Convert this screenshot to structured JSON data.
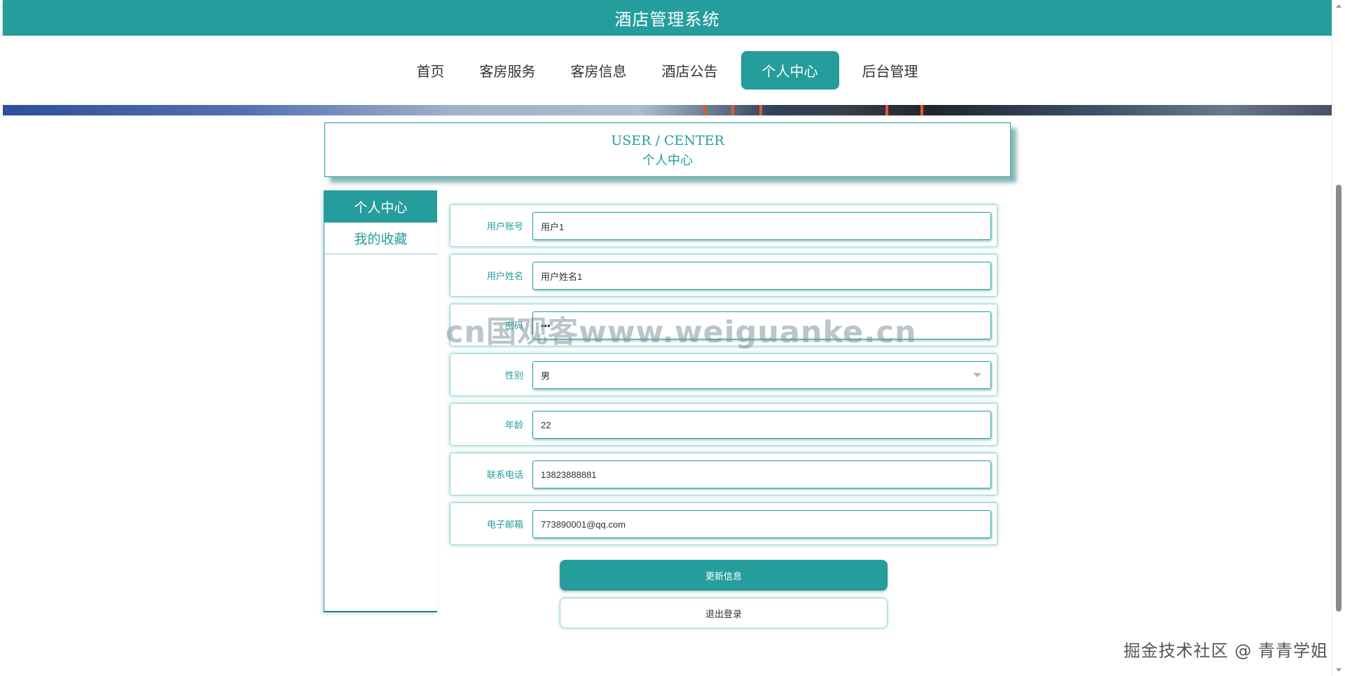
{
  "app": {
    "title": "酒店管理系统"
  },
  "nav": {
    "items": [
      {
        "label": "首页"
      },
      {
        "label": "客房服务"
      },
      {
        "label": "客房信息"
      },
      {
        "label": "酒店公告"
      },
      {
        "label": "个人中心",
        "active": true
      },
      {
        "label": "后台管理"
      }
    ]
  },
  "heading": {
    "en": "USER / CENTER",
    "cn": "个人中心"
  },
  "side_menu": {
    "items": [
      {
        "label": "个人中心",
        "active": true
      },
      {
        "label": "我的收藏"
      }
    ]
  },
  "form": {
    "fields": [
      {
        "label": "用户账号",
        "value": "用户1"
      },
      {
        "label": "用户姓名",
        "value": "用户姓名1"
      },
      {
        "label": "密码",
        "value": "•••"
      },
      {
        "label": "性别",
        "value": "男"
      },
      {
        "label": "年龄",
        "value": "22"
      },
      {
        "label": "联系电话",
        "value": "13823888881"
      },
      {
        "label": "电子邮箱",
        "value": "773890001@qq.com"
      }
    ]
  },
  "actions": {
    "update_label": "更新信息",
    "logout_label": "退出登录"
  },
  "overlay": {
    "watermark": "cn国观客www.weiguanke.cn",
    "credit": "掘金技术社区 @ 青青学姐"
  },
  "colors": {
    "accent": "#259d9d",
    "background": "#ffffff",
    "label_text": "#259d9d"
  },
  "icons": {
    "select_arrow": "chevron-down-icon"
  }
}
